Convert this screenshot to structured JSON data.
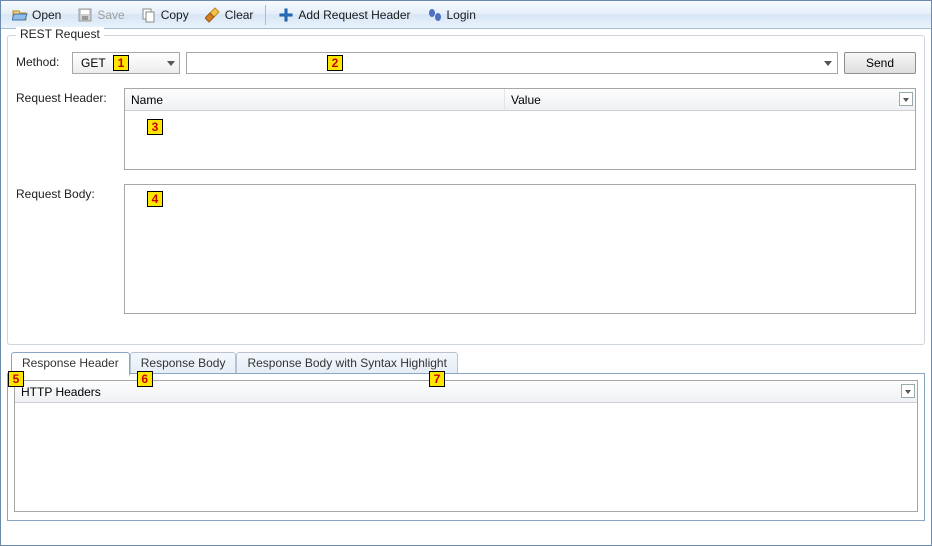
{
  "toolbar": {
    "open": "Open",
    "save": "Save",
    "copy": "Copy",
    "clear": "Clear",
    "add_header": "Add Request Header",
    "login": "Login"
  },
  "panel": {
    "title": "REST Request",
    "method_label": "Method:",
    "method_value": "GET",
    "url_value": "",
    "send_label": "Send",
    "req_header_label": "Request Header:",
    "header_cols": {
      "name": "Name",
      "value": "Value"
    },
    "req_body_label": "Request Body:",
    "body_value": ""
  },
  "tabs": {
    "t1": "Response Header",
    "t2": "Response Body",
    "t3": "Response Body with Syntax Highlight"
  },
  "response": {
    "header_col": "HTTP Headers"
  },
  "annotations": {
    "a1": "1",
    "a2": "2",
    "a3": "3",
    "a4": "4",
    "a5": "5",
    "a6": "6",
    "a7": "7"
  }
}
